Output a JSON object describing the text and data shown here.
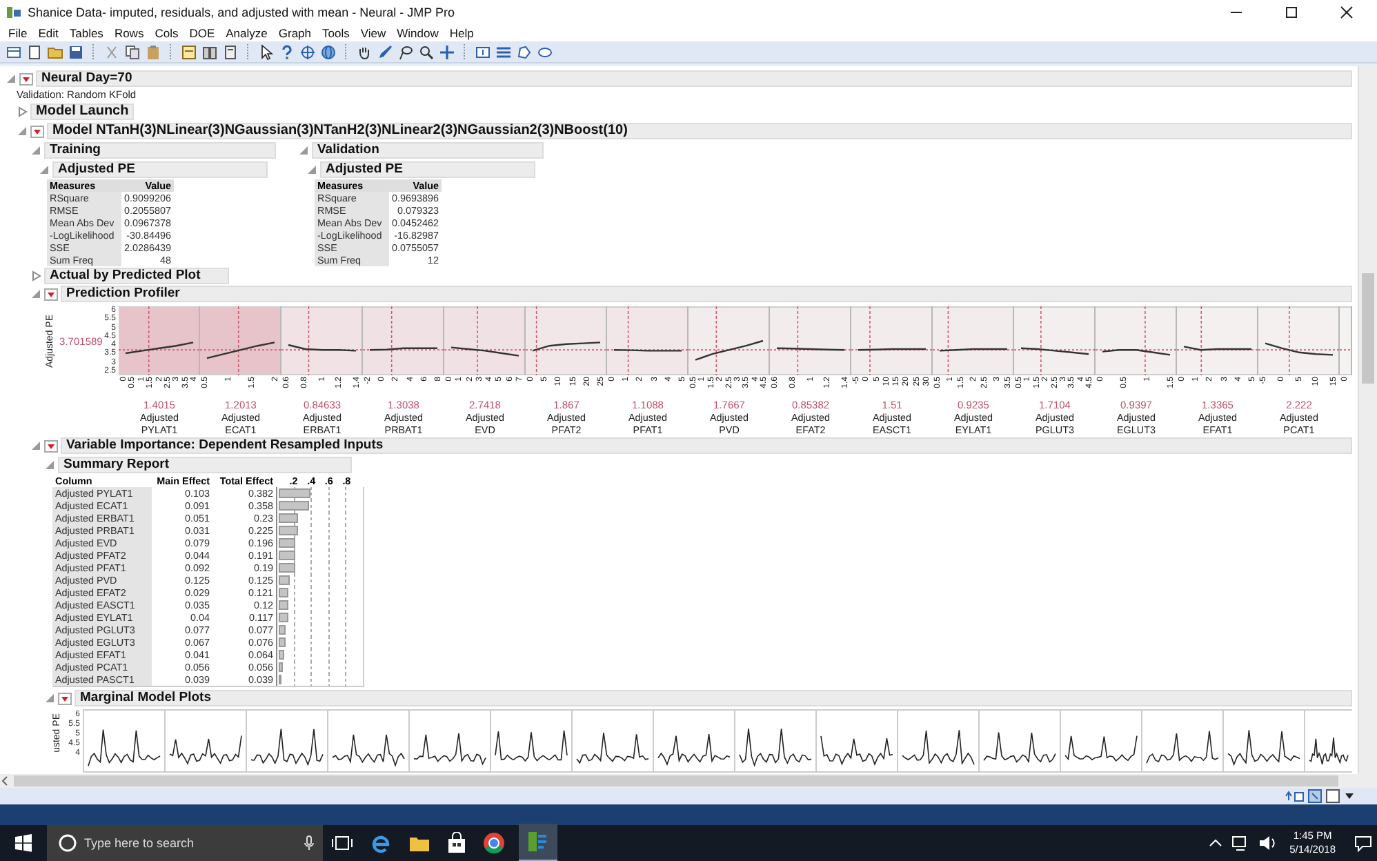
{
  "window": {
    "title": "Shanice Data- imputed, residuals, and adjusted with mean - Neural - JMP Pro"
  },
  "menu": [
    "File",
    "Edit",
    "Tables",
    "Rows",
    "Cols",
    "DOE",
    "Analyze",
    "Graph",
    "Tools",
    "View",
    "Window",
    "Help"
  ],
  "report": {
    "title": "Neural Day=70",
    "expanded": true,
    "note": "Validation: Random KFold",
    "model_launch": {
      "title": "Model Launch",
      "expanded": false
    },
    "model": {
      "title": "Model NTanH(3)NLinear(3)NGaussian(3)NTanH2(3)NLinear2(3)NGaussian2(3)NBoost(10)",
      "expanded": true,
      "sets": [
        {
          "title": "Training",
          "expanded": true,
          "fit": {
            "title": "Adjusted PE",
            "expanded": true,
            "columns": [
              "Measures",
              "Value"
            ],
            "rows": [
              {
                "measure": "RSquare",
                "value": "0.9099206"
              },
              {
                "measure": "RMSE",
                "value": "0.2055807"
              },
              {
                "measure": "Mean Abs Dev",
                "value": "0.0967378"
              },
              {
                "measure": "-LogLikelihood",
                "value": "-30.84496"
              },
              {
                "measure": "SSE",
                "value": "2.0286439"
              },
              {
                "measure": "Sum Freq",
                "value": "48"
              }
            ]
          }
        },
        {
          "title": "Validation",
          "expanded": true,
          "fit": {
            "title": "Adjusted PE",
            "expanded": true,
            "columns": [
              "Measures",
              "Value"
            ],
            "rows": [
              {
                "measure": "RSquare",
                "value": "0.9693896"
              },
              {
                "measure": "RMSE",
                "value": "0.079323"
              },
              {
                "measure": "Mean Abs Dev",
                "value": "0.0452462"
              },
              {
                "measure": "-LogLikelihood",
                "value": "-16.82987"
              },
              {
                "measure": "SSE",
                "value": "0.0755057"
              },
              {
                "measure": "Sum Freq",
                "value": "12"
              }
            ]
          }
        }
      ],
      "actual_by_predicted": {
        "title": "Actual by Predicted Plot",
        "expanded": false
      },
      "profiler": {
        "title": "Prediction Profiler",
        "expanded": true,
        "response": "Adjusted PE",
        "current": "3.701589",
        "yticks": [
          "6",
          "5.5",
          "5",
          "4.5",
          "4",
          "3.5",
          "3",
          "2.5"
        ],
        "factors": [
          {
            "ticks": [
              "0",
              "0.5",
              "1",
              "1.5",
              "2",
              "2.5",
              "3",
              "3.5",
              "4"
            ],
            "value": "1.4015",
            "label": "Adjusted",
            "name": "PYLAT1",
            "color": "#e6c4c9"
          },
          {
            "ticks": [
              "0.5",
              "1",
              "1.5",
              "2"
            ],
            "value": "1.2013",
            "label": "Adjusted",
            "name": "ECAT1",
            "color": "#e6c4c9"
          },
          {
            "ticks": [
              "0.6",
              "0.8",
              "1",
              "1.2",
              "1.4"
            ],
            "value": "0.84633",
            "label": "Adjusted",
            "name": "ERBAT1",
            "color": "#f1e3e5"
          },
          {
            "ticks": [
              "-2",
              "0",
              "2",
              "4",
              "6",
              "8"
            ],
            "value": "1.3038",
            "label": "Adjusted",
            "name": "PRBAT1",
            "color": "#f0e2e4"
          },
          {
            "ticks": [
              "0",
              "1",
              "2",
              "3",
              "4",
              "5",
              "6",
              "7"
            ],
            "value": "2.7418",
            "label": "Adjusted",
            "name": "EVD",
            "color": "#f0e2e4"
          },
          {
            "ticks": [
              "0",
              "5",
              "10",
              "15",
              "20",
              "25"
            ],
            "value": "1.867",
            "label": "Adjusted",
            "name": "PFAT2",
            "color": "#f2e7e8"
          },
          {
            "ticks": [
              "0",
              "1",
              "2",
              "3",
              "4",
              "5"
            ],
            "value": "1.1088",
            "label": "Adjusted",
            "name": "PFAT1",
            "color": "#f2e7e8"
          },
          {
            "ticks": [
              "0.5",
              "1",
              "1.5",
              "2",
              "2.5",
              "3",
              "3.5",
              "4",
              "4.5"
            ],
            "value": "1.7667",
            "label": "Adjusted",
            "name": "PVD",
            "color": "#f3ecec"
          },
          {
            "ticks": [
              "0.6",
              "0.8",
              "1",
              "1.2",
              "1.4"
            ],
            "value": "0.85382",
            "label": "Adjusted",
            "name": "EFAT2",
            "color": "#f3ecec"
          },
          {
            "ticks": [
              "-5",
              "0",
              "5",
              "10",
              "15",
              "20",
              "25",
              "30"
            ],
            "value": "1.51",
            "label": "Adjusted",
            "name": "EASCT1",
            "color": "#f3ecec"
          },
          {
            "ticks": [
              "0.5",
              "1",
              "1.5",
              "2",
              "2.5",
              "3",
              "3.5"
            ],
            "value": "0.9235",
            "label": "Adjusted",
            "name": "EYLAT1",
            "color": "#f3ecec"
          },
          {
            "ticks": [
              "0.5",
              "1",
              "1.5",
              "2",
              "2.5",
              "3",
              "3.5",
              "4",
              "4.5"
            ],
            "value": "1.7104",
            "label": "Adjusted",
            "name": "PGLUT3",
            "color": "#f4efef"
          },
          {
            "ticks": [
              "0",
              "0.5",
              "1",
              "1.5"
            ],
            "value": "0.9397",
            "label": "Adjusted",
            "name": "EGLUT3",
            "color": "#f4efef"
          },
          {
            "ticks": [
              "0",
              "1",
              "2",
              "3",
              "4",
              "5"
            ],
            "value": "1.3365",
            "label": "Adjusted",
            "name": "EFAT1",
            "color": "#f4f0f0"
          },
          {
            "ticks": [
              "-5",
              "0",
              "5",
              "10",
              "15"
            ],
            "value": "2.222",
            "label": "Adjusted",
            "name": "PCAT1",
            "color": "#f4f0f0"
          },
          {
            "ticks": [
              "0"
            ],
            "color": "#f5f2f2"
          }
        ]
      },
      "importance": {
        "title": "Variable Importance: Dependent Resampled Inputs",
        "expanded": true,
        "summary": {
          "title": "Summary Report",
          "expanded": true,
          "columns": [
            "Column",
            "Main Effect",
            "Total Effect"
          ],
          "scale": [
            ".2",
            ".4",
            ".6",
            ".8"
          ],
          "rows": [
            {
              "column": "Adjusted PYLAT1",
              "main": "0.103",
              "total": "0.382",
              "level": 0.382
            },
            {
              "column": "Adjusted ECAT1",
              "main": "0.091",
              "total": "0.358",
              "level": 0.358
            },
            {
              "column": "Adjusted ERBAT1",
              "main": "0.051",
              "total": "0.23",
              "level": 0.23
            },
            {
              "column": "Adjusted PRBAT1",
              "main": "0.031",
              "total": "0.225",
              "level": 0.225
            },
            {
              "column": "Adjusted EVD",
              "main": "0.079",
              "total": "0.196",
              "level": 0.196
            },
            {
              "column": "Adjusted PFAT2",
              "main": "0.044",
              "total": "0.191",
              "level": 0.191
            },
            {
              "column": "Adjusted PFAT1",
              "main": "0.092",
              "total": "0.19",
              "level": 0.19
            },
            {
              "column": "Adjusted PVD",
              "main": "0.125",
              "total": "0.125",
              "level": 0.125
            },
            {
              "column": "Adjusted EFAT2",
              "main": "0.029",
              "total": "0.121",
              "level": 0.121
            },
            {
              "column": "Adjusted EASCT1",
              "main": "0.035",
              "total": "0.12",
              "level": 0.12
            },
            {
              "column": "Adjusted EYLAT1",
              "main": "0.04",
              "total": "0.117",
              "level": 0.117
            },
            {
              "column": "Adjusted PGLUT3",
              "main": "0.077",
              "total": "0.077",
              "level": 0.077
            },
            {
              "column": "Adjusted EGLUT3",
              "main": "0.067",
              "total": "0.076",
              "level": 0.076
            },
            {
              "column": "Adjusted EFAT1",
              "main": "0.041",
              "total": "0.064",
              "level": 0.064
            },
            {
              "column": "Adjusted PCAT1",
              "main": "0.056",
              "total": "0.056",
              "level": 0.056
            },
            {
              "column": "Adjusted PASCT1",
              "main": "0.039",
              "total": "0.039",
              "level": 0.039
            }
          ]
        },
        "marginal": {
          "title": "Marginal Model Plots",
          "expanded": true,
          "ylabel": "usted PE",
          "yticks": [
            "6",
            "5.5",
            "5",
            "4.5",
            "4"
          ]
        }
      }
    }
  },
  "taskbar": {
    "search": {
      "placeholder": "Type here to search"
    },
    "time": "1:45 PM",
    "date": "5/14/2018"
  }
}
